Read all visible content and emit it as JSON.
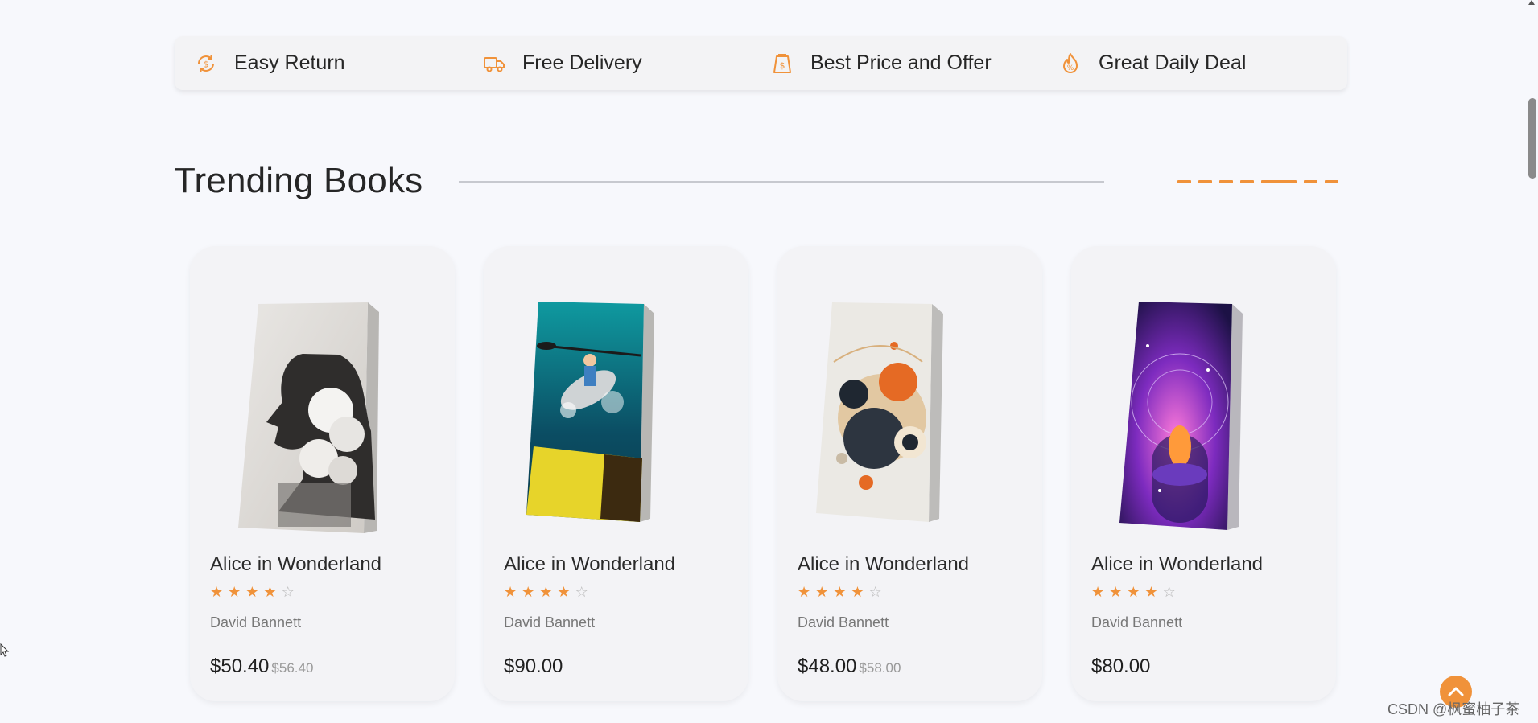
{
  "features": [
    {
      "label": "Easy Return",
      "icon": "return-coin-icon"
    },
    {
      "label": "Free Delivery",
      "icon": "delivery-truck-icon"
    },
    {
      "label": "Best Price and Offer",
      "icon": "price-tag-icon"
    },
    {
      "label": "Great Daily Deal",
      "icon": "deal-flame-icon"
    }
  ],
  "section": {
    "title": "Trending Books"
  },
  "books": [
    {
      "name": "Alice in Wonderland",
      "rating": 4,
      "author": "David Bannett",
      "price": "$50.40",
      "old_price": "$56.40",
      "cover": "profile-clouds-cover"
    },
    {
      "name": "Alice in Wonderland",
      "rating": 4,
      "author": "David Bannett",
      "price": "$90.00",
      "old_price": "",
      "cover": "kayaker-cover"
    },
    {
      "name": "Alice in Wonderland",
      "rating": 4,
      "author": "David Bannett",
      "price": "$48.00",
      "old_price": "$58.00",
      "cover": "abstract-circles-cover"
    },
    {
      "name": "Alice in Wonderland",
      "rating": 4,
      "author": "David Bannett",
      "price": "$80.00",
      "old_price": "",
      "cover": "cosmic-meditation-cover"
    }
  ],
  "colors": {
    "accent": "#f0923a",
    "background": "#f7f8fc",
    "card": "#f3f3f6"
  },
  "watermark": "CSDN @枫蜜柚子茶"
}
